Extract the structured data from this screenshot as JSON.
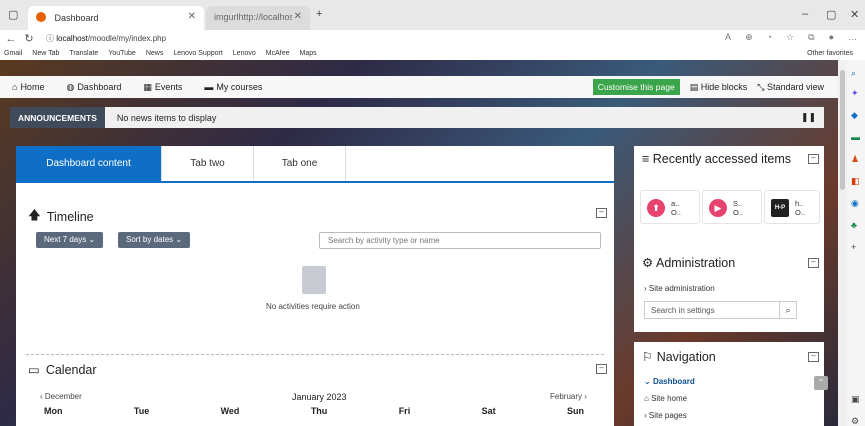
{
  "browser": {
    "active_tab_title": "Dashboard",
    "inactive_tab_title": "imgurlhttp://localhost/moodle/",
    "url_host": "localhost",
    "url_path": "/moodle/my/index.php",
    "bookmarks": [
      "Gmail",
      "New Tab",
      "Translate",
      "YouTube",
      "News",
      "Lenovo Support",
      "Lenovo",
      "McAfee",
      "Maps"
    ],
    "other_favorites": "Other favorites"
  },
  "navbar": {
    "home": "Home",
    "dashboard": "Dashboard",
    "events": "Events",
    "my_courses": "My courses",
    "customise": "Customise this page",
    "hide_blocks": "Hide blocks",
    "standard_view": "Standard view"
  },
  "announcement": {
    "label": "ANNOUNCEMENTS",
    "message": "No news items to display"
  },
  "tabs": [
    "Dashboard content",
    "Tab two",
    "Tab one"
  ],
  "timeline": {
    "title": "Timeline",
    "filter_days": "Next 7 days",
    "sort": "Sort by dates",
    "search_placeholder": "Search by activity type or name",
    "empty_message": "No activities require action"
  },
  "calendar": {
    "title": "Calendar",
    "prev": "December",
    "month": "January 2023",
    "next": "February",
    "days": [
      "Mon",
      "Tue",
      "Wed",
      "Thu",
      "Fri",
      "Sat",
      "Sun"
    ]
  },
  "recent": {
    "title": "Recently accessed items",
    "items": [
      {
        "line1": "a..",
        "line2": "O..",
        "color": "#e8436f"
      },
      {
        "line1": "S..",
        "line2": "O..",
        "color": "#e8436f"
      },
      {
        "line1": "h..",
        "line2": "O..",
        "color": "#222222",
        "badge": "H-P"
      }
    ]
  },
  "admin": {
    "title": "Administration",
    "link": "Site administration",
    "search_placeholder": "Search in settings"
  },
  "navigation": {
    "title": "Navigation",
    "items": [
      "Dashboard",
      "Site home",
      "Site pages"
    ]
  }
}
